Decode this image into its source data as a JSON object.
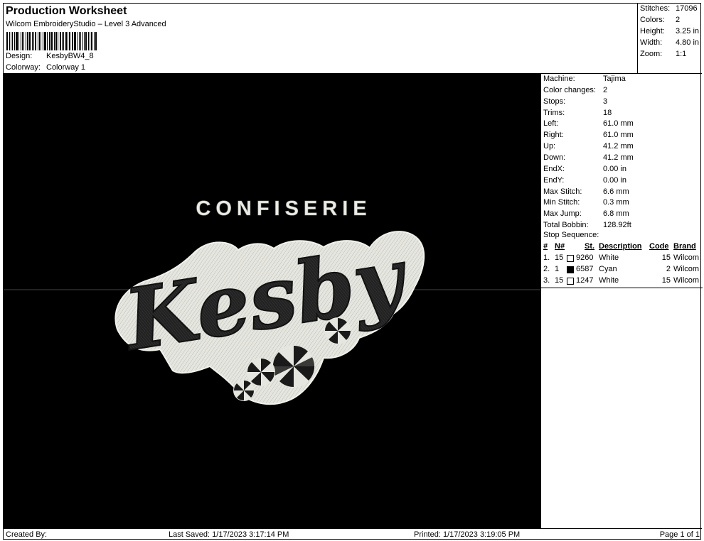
{
  "header": {
    "title": "Production Worksheet",
    "subtitle": "Wilcom EmbroideryStudio – Level 3 Advanced",
    "design_label": "Design:",
    "design_value": "KesbyBW4_8",
    "colorway_label": "Colorway:",
    "colorway_value": "Colorway 1"
  },
  "stats": [
    {
      "label": "Stitches:",
      "value": "17096"
    },
    {
      "label": "Colors:",
      "value": "2"
    },
    {
      "label": "Height:",
      "value": "3.25 in"
    },
    {
      "label": "Width:",
      "value": "4.80 in"
    },
    {
      "label": "Zoom:",
      "value": "1:1"
    }
  ],
  "design": {
    "top_text": "CONFISERIE",
    "main_text": "Kesby"
  },
  "machine_info": [
    {
      "label": "Machine:",
      "value": "Tajima"
    },
    {
      "label": "Color changes:",
      "value": "2"
    },
    {
      "label": "Stops:",
      "value": "3"
    },
    {
      "label": "Trims:",
      "value": "18"
    },
    {
      "label": "Left:",
      "value": "61.0 mm"
    },
    {
      "label": "Right:",
      "value": "61.0 mm"
    },
    {
      "label": "Up:",
      "value": "41.2 mm"
    },
    {
      "label": "Down:",
      "value": "41.2 mm"
    },
    {
      "label": "EndX:",
      "value": "0.00 in"
    },
    {
      "label": "EndY:",
      "value": "0.00 in"
    },
    {
      "label": "Max Stitch:",
      "value": "6.6 mm"
    },
    {
      "label": "Min Stitch:",
      "value": "0.3 mm"
    },
    {
      "label": "Max Jump:",
      "value": "6.8 mm"
    },
    {
      "label": "Total Bobbin:",
      "value": "128.92ft"
    }
  ],
  "stop_sequence": {
    "title": "Stop Sequence:",
    "headers": {
      "num": "#",
      "n": "N#",
      "st": "St.",
      "description": "Description",
      "code": "Code",
      "brand": "Brand"
    },
    "rows": [
      {
        "num": "1.",
        "n": "15",
        "swatch": "#ffffff",
        "st": "9260",
        "description": "White",
        "code": "15",
        "brand": "Wilcom"
      },
      {
        "num": "2.",
        "n": "1",
        "swatch": "#000000",
        "st": "6587",
        "description": "Cyan",
        "code": "2",
        "brand": "Wilcom"
      },
      {
        "num": "3.",
        "n": "15",
        "swatch": "#ffffff",
        "st": "1247",
        "description": "White",
        "code": "15",
        "brand": "Wilcom"
      }
    ]
  },
  "footer": {
    "created_by": "Created By:",
    "last_saved": "Last Saved: 1/17/2023 3:17:14 PM",
    "printed": "Printed: 1/17/2023 3:19:05 PM",
    "page": "Page 1 of 1"
  },
  "colors": {
    "background": "#000000",
    "thread_white": "#e8e8e2",
    "thread_black": "#1a1a1a"
  }
}
